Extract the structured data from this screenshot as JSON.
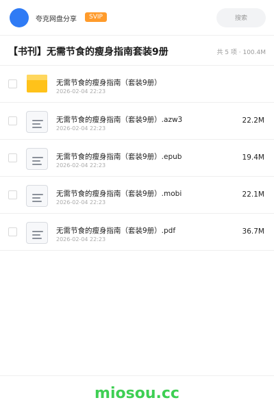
{
  "header": {
    "app_name": "夸克网盘分享",
    "badge": "SVIP",
    "search_label": "搜索"
  },
  "share": {
    "title": "【书刊】无需节食的瘦身指南套装9册",
    "summary": "共 5 项 · 100.4M"
  },
  "files": [
    {
      "type": "folder",
      "icon": "folder-icon",
      "name": "无需节食的瘦身指南（套装9册）",
      "date": "2026-02-04 22:23",
      "size": ""
    },
    {
      "type": "file",
      "icon": "document-icon",
      "name": "无需节食的瘦身指南（套装9册）.azw3",
      "date": "2026-02-04 22:23",
      "size": "22.2M"
    },
    {
      "type": "file",
      "icon": "document-icon",
      "name": "无需节食的瘦身指南（套装9册）.epub",
      "date": "2026-02-04 22:23",
      "size": "19.4M"
    },
    {
      "type": "file",
      "icon": "document-icon",
      "name": "无需节食的瘦身指南（套装9册）.mobi",
      "date": "2026-02-04 22:23",
      "size": "22.1M"
    },
    {
      "type": "file",
      "icon": "document-icon",
      "name": "无需节食的瘦身指南（套装9册）.pdf",
      "date": "2026-02-04 22:23",
      "size": "36.7M"
    }
  ],
  "footer": {
    "watermark": "miosou.cc"
  },
  "colors": {
    "accent": "#2f7bf5",
    "badge": "#ff9b2b",
    "folder": "#ffc21a",
    "watermark": "#3ecf53"
  }
}
